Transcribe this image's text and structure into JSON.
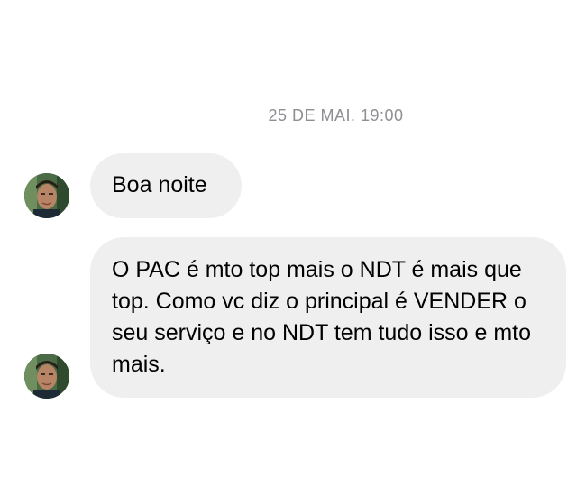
{
  "conversation": {
    "timestamp": "25 DE MAI. 19:00",
    "messages": [
      {
        "sender": "contact",
        "text": "Boa noite"
      },
      {
        "sender": "contact",
        "text": "O PAC é mto top mais o NDT é mais que top. Como vc diz o principal é VENDER o seu serviço e no NDT tem tudo isso e mto mais."
      }
    ]
  },
  "colors": {
    "bubble_background": "#efefef",
    "timestamp_text": "#8e8e93",
    "page_background": "#ffffff"
  },
  "icons": {
    "avatar": "contact-avatar-photo"
  }
}
